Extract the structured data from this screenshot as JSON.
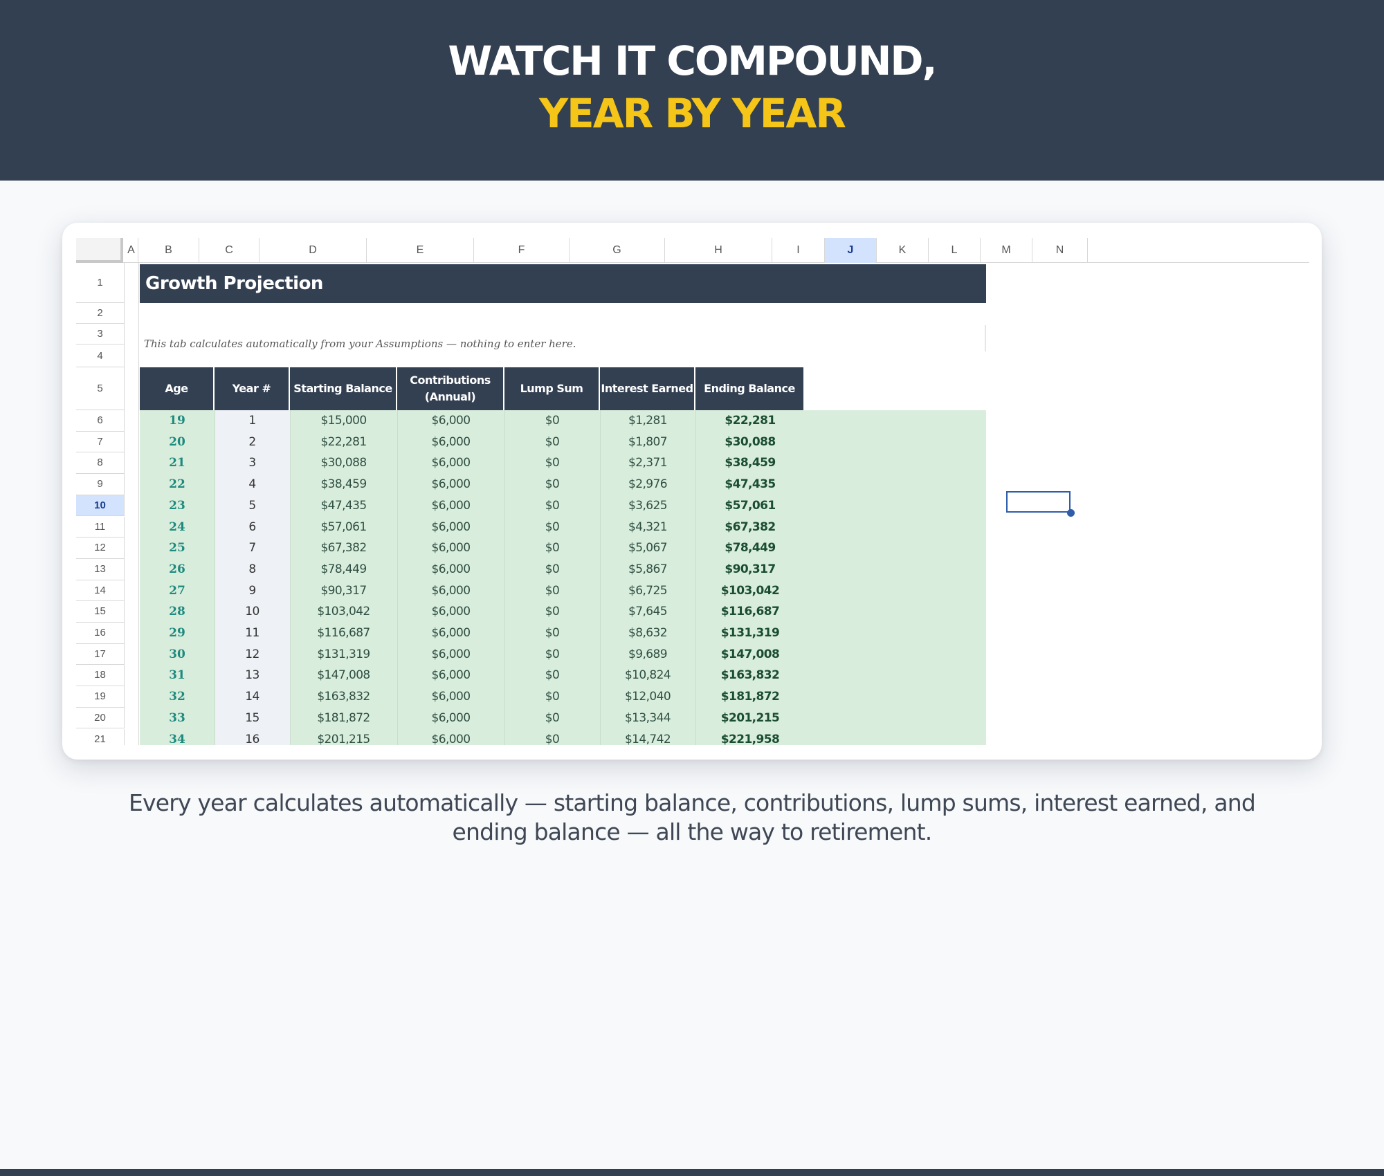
{
  "banner": {
    "line1": "WATCH IT COMPOUND,",
    "line2": "YEAR BY YEAR"
  },
  "sheet": {
    "columns": [
      "A",
      "B",
      "C",
      "D",
      "E",
      "F",
      "G",
      "H",
      "I",
      "J",
      "K",
      "L",
      "M",
      "N"
    ],
    "active_column": "J",
    "row_numbers": [
      "1",
      "2",
      "3",
      "4",
      "5",
      "6",
      "7",
      "8",
      "9",
      "10",
      "11",
      "12",
      "13",
      "14",
      "15",
      "16",
      "17",
      "18",
      "19",
      "20",
      "21"
    ],
    "active_row": "10",
    "title": "Growth Projection",
    "note": "This tab calculates automatically from your Assumptions — nothing to enter here.",
    "headers": [
      "Age",
      "Year #",
      "Starting Balance",
      "Contributions (Annual)",
      "Lump Sum",
      "Interest Earned",
      "Ending Balance"
    ],
    "rows": [
      [
        "19",
        "1",
        "$15,000",
        "$6,000",
        "$0",
        "$1,281",
        "$22,281"
      ],
      [
        "20",
        "2",
        "$22,281",
        "$6,000",
        "$0",
        "$1,807",
        "$30,088"
      ],
      [
        "21",
        "3",
        "$30,088",
        "$6,000",
        "$0",
        "$2,371",
        "$38,459"
      ],
      [
        "22",
        "4",
        "$38,459",
        "$6,000",
        "$0",
        "$2,976",
        "$47,435"
      ],
      [
        "23",
        "5",
        "$47,435",
        "$6,000",
        "$0",
        "$3,625",
        "$57,061"
      ],
      [
        "24",
        "6",
        "$57,061",
        "$6,000",
        "$0",
        "$4,321",
        "$67,382"
      ],
      [
        "25",
        "7",
        "$67,382",
        "$6,000",
        "$0",
        "$5,067",
        "$78,449"
      ],
      [
        "26",
        "8",
        "$78,449",
        "$6,000",
        "$0",
        "$5,867",
        "$90,317"
      ],
      [
        "27",
        "9",
        "$90,317",
        "$6,000",
        "$0",
        "$6,725",
        "$103,042"
      ],
      [
        "28",
        "10",
        "$103,042",
        "$6,000",
        "$0",
        "$7,645",
        "$116,687"
      ],
      [
        "29",
        "11",
        "$116,687",
        "$6,000",
        "$0",
        "$8,632",
        "$131,319"
      ],
      [
        "30",
        "12",
        "$131,319",
        "$6,000",
        "$0",
        "$9,689",
        "$147,008"
      ],
      [
        "31",
        "13",
        "$147,008",
        "$6,000",
        "$0",
        "$10,824",
        "$163,832"
      ],
      [
        "32",
        "14",
        "$163,832",
        "$6,000",
        "$0",
        "$12,040",
        "$181,872"
      ],
      [
        "33",
        "15",
        "$181,872",
        "$6,000",
        "$0",
        "$13,344",
        "$201,215"
      ],
      [
        "34",
        "16",
        "$201,215",
        "$6,000",
        "$0",
        "$14,742",
        "$221,958"
      ]
    ]
  },
  "caption": "Every year calculates automatically — starting balance, contributions, lump sums, interest earned, and ending balance — all the way to retirement.",
  "colors": {
    "navy": "#334052",
    "gold": "#f5c518",
    "mint": "#d9eddd",
    "teal": "#1e8a7e",
    "selection": "#2e5eaa"
  }
}
